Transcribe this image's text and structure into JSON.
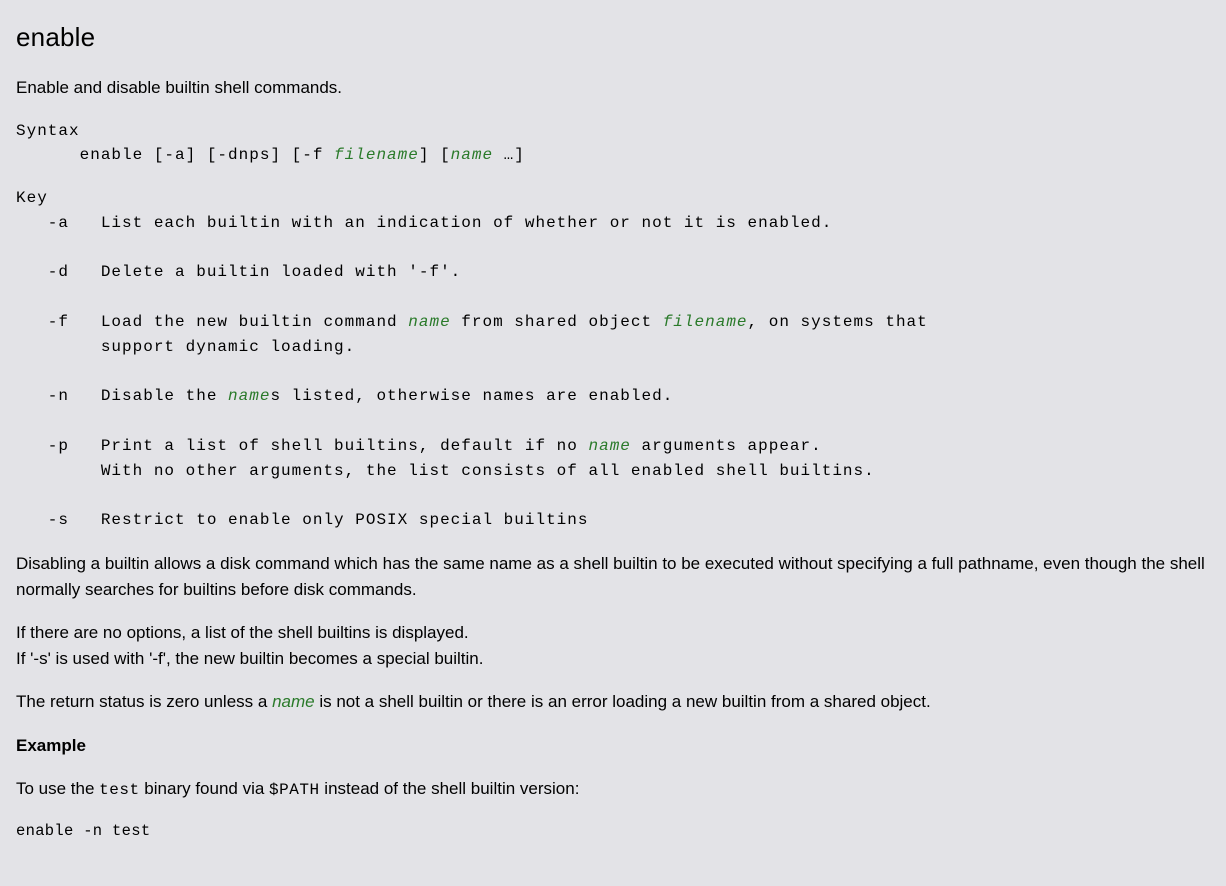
{
  "title": "enable",
  "intro": "Enable and disable builtin shell commands.",
  "syntax": {
    "label": "Syntax",
    "prefix": "      enable [-a] [-dnps] [-f ",
    "filename": "filename",
    "between": "] [",
    "name": "name",
    "suffix": " …]"
  },
  "key": {
    "label": "Key",
    "a": "   -a   List each builtin with an indication of whether or not it is enabled.",
    "d": "   -d   Delete a builtin loaded with '-f'.",
    "f1_pre": "   -f   Load the new builtin command ",
    "f1_name": "name",
    "f1_mid": " from shared object ",
    "f1_file": "filename",
    "f1_post": ", on systems that",
    "f2": "        support dynamic loading.",
    "n_pre": "   -n   Disable the ",
    "n_name": "name",
    "n_post": "s listed, otherwise names are enabled.",
    "p1_pre": "   -p   Print a list of shell builtins, default if no ",
    "p1_name": "name",
    "p1_post": " arguments appear.",
    "p2": "        With no other arguments, the list consists of all enabled shell builtins.",
    "s": "   -s   Restrict to enable only POSIX special builtins"
  },
  "para1": "Disabling a builtin allows a disk command which has the same name as a shell builtin to be executed without specifying a full pathname, even though the shell normally searches for builtins before disk commands.",
  "para2a": "If there are no options, a list of the shell builtins is displayed.",
  "para2b": "If '-s' is used with '-f', the new builtin becomes a special builtin.",
  "para3_pre": "The return status is zero unless a ",
  "para3_name": "name",
  "para3_post": " is not a shell builtin or there is an error loading a new builtin from a shared object.",
  "example_heading": "Example",
  "example_pre": "To use the ",
  "example_code1": "test",
  "example_mid": " binary found via ",
  "example_code2": "$PATH",
  "example_post": " instead of the shell builtin version:",
  "example_cmd": "enable -n test"
}
